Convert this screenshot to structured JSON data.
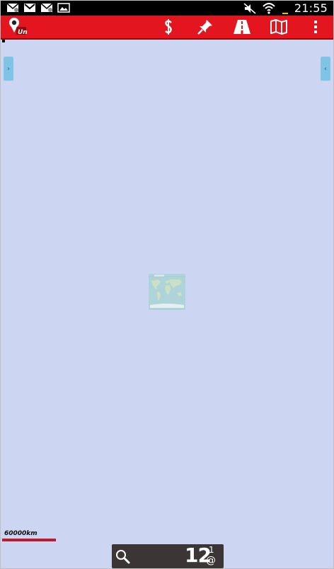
{
  "status_bar": {
    "time": "21:55",
    "icons_left": [
      "email-notification-icon",
      "gmail-icon",
      "email-notification-icon",
      "image-icon"
    ],
    "icons_right": [
      "mute-icon",
      "wifi-icon",
      "battery-icon"
    ]
  },
  "app_bar": {
    "background": "#e3151f",
    "logo_icon": "app-logo-icon",
    "actions": [
      "currency-icon",
      "pin-icon",
      "road-icon",
      "map-icon",
      "overflow-menu-icon"
    ]
  },
  "map": {
    "background": "#ccd6f3",
    "left_tab_glyph": "›",
    "right_tab_glyph": "‹",
    "scale_label": "60000km",
    "scale_color": "#c3182a"
  },
  "bottom_widget": {
    "search_icon": "search-icon",
    "zoom_level": "12",
    "superscript": "1",
    "subscript": "@"
  }
}
